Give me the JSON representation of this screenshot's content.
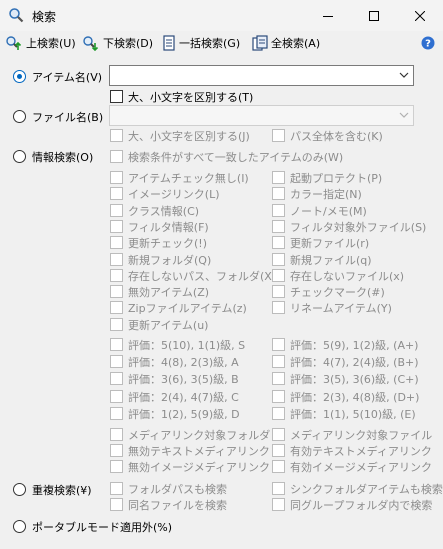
{
  "window": {
    "title": "検索"
  },
  "toolbar": {
    "search_up": "上検索(U)",
    "search_down": "下検索(D)",
    "search_all_batch": "一括検索(G)",
    "search_all": "全検索(A)"
  },
  "options": {
    "item_name": "アイテム名(V)",
    "item_case": "大、小文字を区別する(T)",
    "file_name": "ファイル名(B)",
    "file_case": "大、小文字を区別する(J)",
    "whole_path": "パス全体を含む(K)",
    "info_search": "情報検索(O)",
    "all_match": "検索条件がすべて一致したアイテムのみ(W)",
    "dup_search": "重複検索(¥)",
    "portable": "ポータブルモード適用外(%)"
  },
  "info_left": [
    "アイテムチェック無し(I)",
    "イメージリンク(L)",
    "クラス情報(C)",
    "フィルタ情報(F)",
    "更新チェック(!)",
    "新規フォルダ(Q)",
    "存在しないパス、フォルダ(X)",
    "無効アイテム(Z)",
    "Zipファイルアイテム(z)",
    "更新アイテム(u)"
  ],
  "info_right": [
    "起動プロテクト(P)",
    "カラー指定(N)",
    "ノート/メモ(M)",
    "フィルタ対象外ファイル(S)",
    "更新ファイル(r)",
    "新規ファイル(q)",
    "存在しないファイル(x)",
    "チェックマーク(#)",
    "リネームアイテム(Y)"
  ],
  "eval_left": [
    "評価：5(10), 1(1)級, S",
    "評価：4(8), 2(3)級, A",
    "評価：3(6), 3(5)級, B",
    "評価：2(4), 4(7)級, C",
    "評価：1(2), 5(9)級, D"
  ],
  "eval_right": [
    "評価：5(9), 1(2)級, (A+)",
    "評価：4(7), 2(4)級, (B+)",
    "評価：3(5), 3(6)級, (C+)",
    "評価：2(3), 4(8)級, (D+)",
    "評価：1(1), 5(10)級, (E)"
  ],
  "media_left": [
    "メディアリンク対象フォルダ",
    "無効テキストメディアリンク",
    "無効イメージメディアリンク"
  ],
  "media_right": [
    "メディアリンク対象ファイル",
    "有効テキストメディアリンク",
    "有効イメージメディアリンク"
  ],
  "dup_left": [
    "フォルダパスも検索",
    "同名ファイルを検索"
  ],
  "dup_right": [
    "シンクフォルダアイテムも検索",
    "同グループフォルダ内で検索"
  ]
}
